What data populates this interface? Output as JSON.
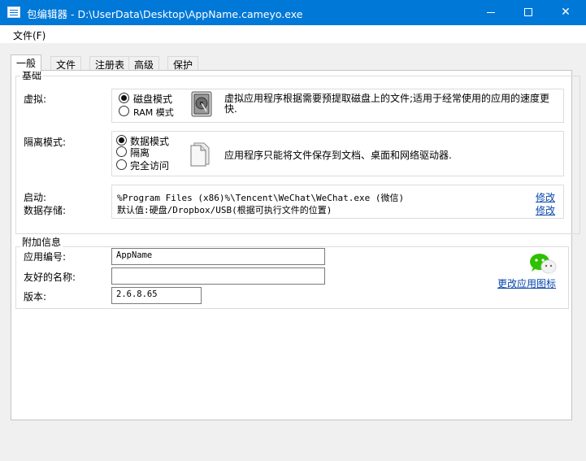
{
  "window": {
    "title": "包编辑器 - D:\\UserData\\Desktop\\AppName.cameyo.exe"
  },
  "menu": {
    "file": "文件(F)"
  },
  "tabs": [
    "一般",
    "文件",
    "注册表",
    "高级",
    "保护"
  ],
  "basic": {
    "group_title": "基础",
    "virtual": {
      "label": "虚拟:",
      "options": [
        "磁盘模式",
        "RAM 模式"
      ],
      "selected": "磁盘模式",
      "icon": "hard-drive-icon",
      "description": "虚拟应用程序根据需要预提取磁盘上的文件;适用于经常使用的应用的速度更快."
    },
    "isolation": {
      "label": "隔离模式:",
      "options": [
        "数据模式",
        "隔离",
        "完全访问"
      ],
      "selected": "数据模式",
      "icon": "document-icon",
      "description": "应用程序只能将文件保存到文档、桌面和网络驱动器."
    },
    "startup": {
      "label": "启动:",
      "value": "%Program Files (x86)%\\Tencent\\WeChat\\WeChat.exe (微信)",
      "edit": "修改"
    },
    "storage": {
      "label": "数据存储:",
      "value": "默认值:硬盘/Dropbox/USB(根据可执行文件的位置)",
      "edit": "修改"
    }
  },
  "extra": {
    "group_title": "附加信息",
    "app_id_label": "应用编号:",
    "app_id_value": "AppName",
    "friendly_name_label": "友好的名称:",
    "friendly_name_value": "",
    "version_label": "版本:",
    "version_value": "2.6.8.65",
    "app_icon": "wechat-icon",
    "change_icon_link": "更改应用图标"
  },
  "colors": {
    "titlebar": "#0078d7",
    "link": "#0645ad",
    "wechat_green": "#2dc100"
  }
}
